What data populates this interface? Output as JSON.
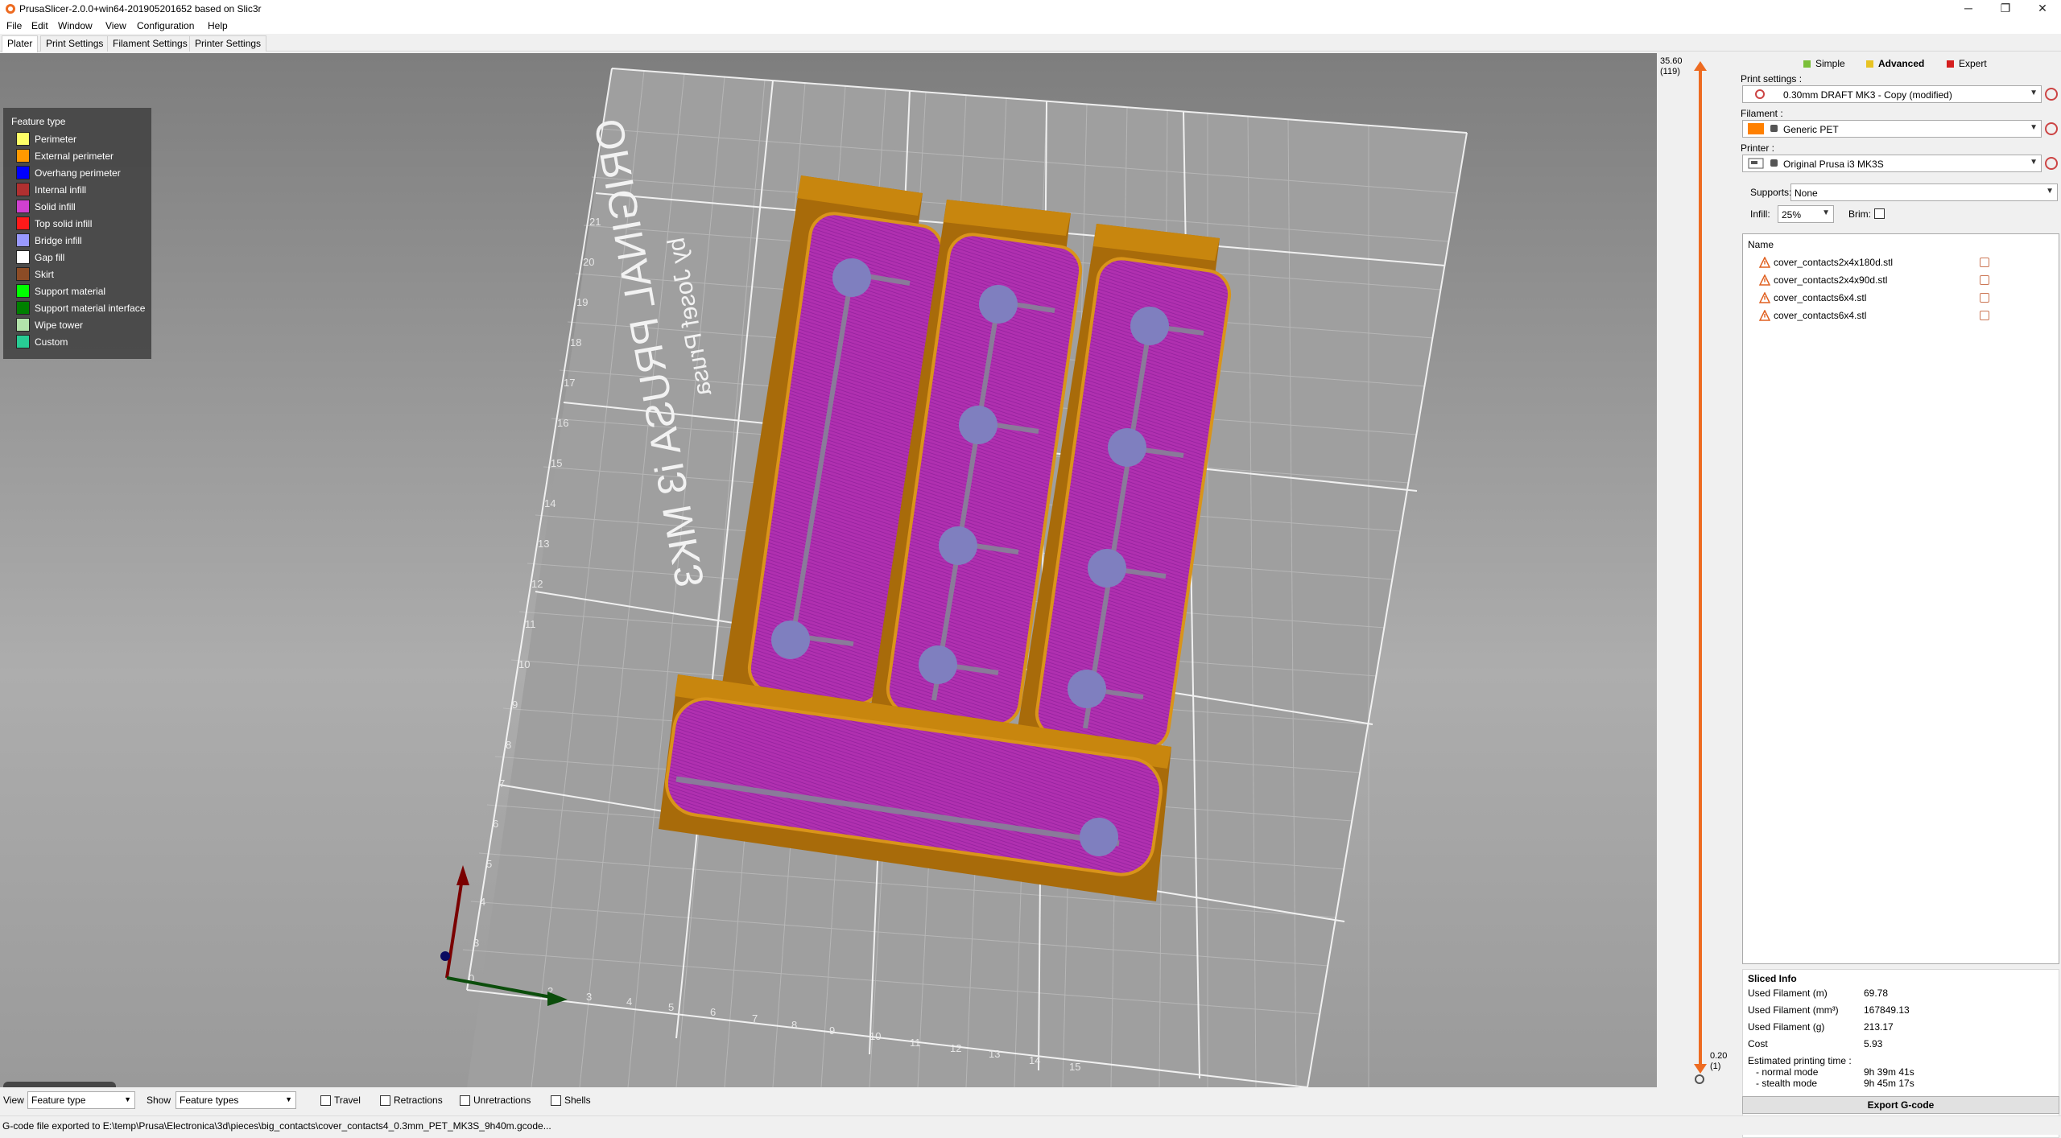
{
  "window": {
    "title": "PrusaSlicer-2.0.0+win64-201905201652 based on Slic3r",
    "controls": [
      "─",
      "❐",
      "✕"
    ]
  },
  "menu": [
    "File",
    "Edit",
    "Window",
    "View",
    "Configuration",
    "Help"
  ],
  "tabs": [
    "Plater",
    "Print Settings",
    "Filament Settings",
    "Printer Settings"
  ],
  "legend": {
    "title": "Feature type",
    "items": [
      {
        "label": "Perimeter",
        "color": "#ffff66"
      },
      {
        "label": "External perimeter",
        "color": "#ff9900"
      },
      {
        "label": "Overhang perimeter",
        "color": "#0000ff"
      },
      {
        "label": "Internal infill",
        "color": "#b03030"
      },
      {
        "label": "Solid infill",
        "color": "#d040d0"
      },
      {
        "label": "Top solid infill",
        "color": "#ff1a1a"
      },
      {
        "label": "Bridge infill",
        "color": "#9999ff"
      },
      {
        "label": "Gap fill",
        "color": "#ffffff"
      },
      {
        "label": "Skirt",
        "color": "#8c4c26"
      },
      {
        "label": "Support material",
        "color": "#00ff00"
      },
      {
        "label": "Support material interface",
        "color": "#008000"
      },
      {
        "label": "Wipe tower",
        "color": "#b3e3ab"
      },
      {
        "label": "Custom",
        "color": "#28cc94"
      }
    ]
  },
  "bed_labels": {
    "text_line1": "ORIGINAL PRUSA i3 MK3",
    "text_line2": "by Josef Prusa",
    "x_ticks": [
      "0",
      "2",
      "3",
      "4",
      "5",
      "6",
      "7",
      "8",
      "9",
      "10",
      "11",
      "12",
      "13",
      "14",
      "15"
    ],
    "y_ticks": [
      "0",
      "1",
      "2",
      "3",
      "4",
      "5",
      "6",
      "7",
      "8",
      "9",
      "10",
      "11",
      "12",
      "13",
      "14",
      "15",
      "16",
      "17",
      "18",
      "19",
      "20",
      "21"
    ]
  },
  "layer_slider": {
    "top_value": "35.60",
    "top_layer": "(119)",
    "bottom_value": "0.20",
    "bottom_layer": "(1)"
  },
  "modes": [
    {
      "label": "Simple",
      "color": "#7bbf3a"
    },
    {
      "label": "Advanced",
      "color": "#e8c323"
    },
    {
      "label": "Expert",
      "color": "#d41e1e"
    }
  ],
  "right_panel": {
    "print_settings_label": "Print settings :",
    "print_settings_value": "0.30mm DRAFT MK3 - Copy (modified)",
    "filament_label": "Filament :",
    "filament_value": "Generic PET",
    "filament_color": "#ff8000",
    "printer_label": "Printer :",
    "printer_value": "Original Prusa i3 MK3S",
    "supports_label": "Supports:",
    "supports_value": "None",
    "infill_label": "Infill:",
    "infill_value": "25%",
    "brim_label": "Brim:",
    "objects_header": "Name",
    "objects": [
      "cover_contacts2x4x180d.stl",
      "cover_contacts2x4x90d.stl",
      "cover_contacts6x4.stl",
      "cover_contacts6x4.stl"
    ]
  },
  "sliced_info": {
    "title": "Sliced Info",
    "rows": [
      {
        "label": "Used Filament (m)",
        "value": "69.78"
      },
      {
        "label": "Used Filament (mm³)",
        "value": "167849.13"
      },
      {
        "label": "Used Filament (g)",
        "value": "213.17"
      },
      {
        "label": "Cost",
        "value": "5.93"
      }
    ],
    "time_label": "Estimated printing time :",
    "normal_label": "- normal mode",
    "normal_value": "9h 39m 41s",
    "stealth_label": "- stealth mode",
    "stealth_value": "9h 45m 17s"
  },
  "export_button": "Export G-code",
  "bottom_bar": {
    "view_label": "View",
    "view_value": "Feature type",
    "show_label": "Show",
    "show_value": "Feature types",
    "checks": [
      "Travel",
      "Retractions",
      "Unretractions",
      "Shells"
    ]
  },
  "status": "G-code file exported to E:\\temp\\Prusa\\Electronica\\3d\\pieces\\big_contacts\\cover_contacts4_0.3mm_PET_MK3S_9h40m.gcode..."
}
